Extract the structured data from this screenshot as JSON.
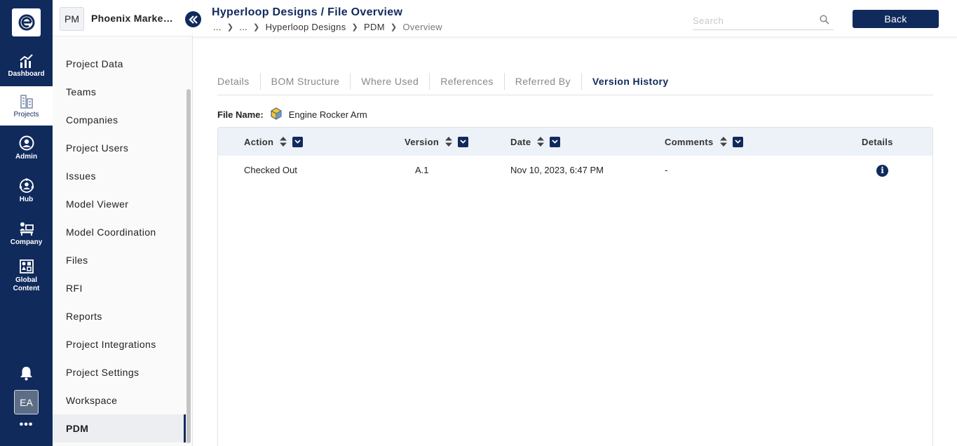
{
  "rail": {
    "items": [
      {
        "label": "Dashboard",
        "icon": "chart-icon"
      },
      {
        "label": "Projects",
        "icon": "buildings-icon"
      },
      {
        "label": "Admin",
        "icon": "admin-icon"
      },
      {
        "label": "Hub",
        "icon": "hub-icon"
      },
      {
        "label": "Company",
        "icon": "company-icon"
      },
      {
        "label": "Global Content",
        "icon": "global-content-icon"
      }
    ],
    "avatar": "EA",
    "more": "•••"
  },
  "sidebar": {
    "project_initials": "PM",
    "project_name": "Phoenix Marketplace",
    "items": [
      "Project Data",
      "Teams",
      "Companies",
      "Project Users",
      "Issues",
      "Model Viewer",
      "Model Coordination",
      "Files",
      "RFI",
      "Reports",
      "Project Integrations",
      "Project Settings",
      "Workspace",
      "PDM"
    ],
    "active_item": "PDM"
  },
  "header": {
    "title": "Hyperloop Designs / File Overview",
    "breadcrumb": [
      "...",
      "...",
      "Hyperloop Designs",
      "PDM",
      "Overview"
    ],
    "search_placeholder": "Search",
    "back_label": "Back"
  },
  "tabs": {
    "items": [
      "Details",
      "BOM Structure",
      "Where Used",
      "References",
      "Referred By",
      "Version History"
    ],
    "active": "Version History"
  },
  "file": {
    "label": "File Name:",
    "name": "Engine Rocker Arm"
  },
  "table": {
    "columns": [
      "Action",
      "Version",
      "Date",
      "Comments",
      "Details"
    ],
    "rows": [
      {
        "action": "Checked Out",
        "version": "A.1",
        "date": "Nov 10, 2023, 6:47 PM",
        "comments": "-",
        "details_icon": "i"
      }
    ]
  },
  "colors": {
    "brand_navy": "#102a5c",
    "header_row_bg": "#edf2f9",
    "sidebar_bg": "#fafafa"
  }
}
